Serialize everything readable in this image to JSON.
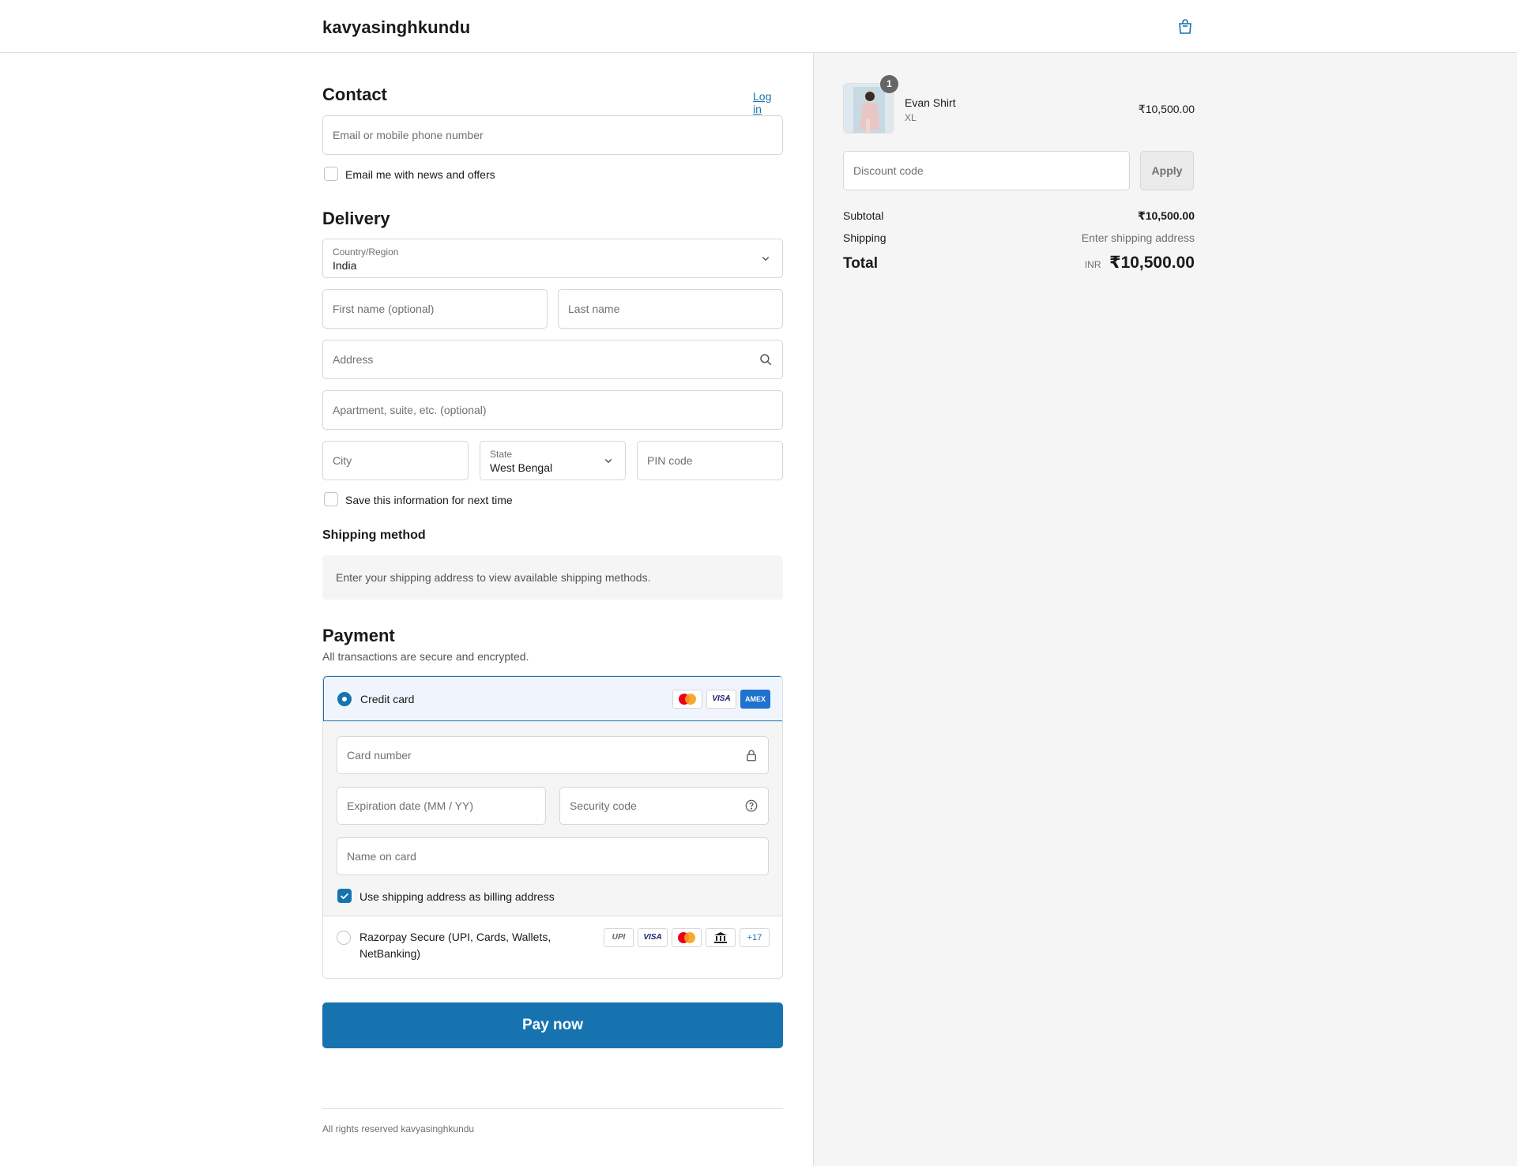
{
  "header": {
    "brand": "kavyasinghkundu",
    "bag_icon": "shopping-bag-icon"
  },
  "contact": {
    "title": "Contact",
    "login_label": "Log in",
    "email_placeholder": "Email or mobile phone number",
    "news_label": "Email me with news and offers"
  },
  "delivery": {
    "title": "Delivery",
    "country_label": "Country/Region",
    "country_value": "India",
    "first_name_placeholder": "First name (optional)",
    "last_name_placeholder": "Last name",
    "address_placeholder": "Address",
    "apartment_placeholder": "Apartment, suite, etc. (optional)",
    "city_placeholder": "City",
    "state_label": "State",
    "state_value": "West Bengal",
    "pin_placeholder": "PIN code",
    "save_label": "Save this information for next time"
  },
  "shipping": {
    "title": "Shipping method",
    "message": "Enter your shipping address to view available shipping methods."
  },
  "payment": {
    "title": "Payment",
    "subtitle": "All transactions are secure and encrypted.",
    "credit_card_label": "Credit card",
    "card_logos": [
      "mastercard",
      "VISA",
      "AMEX"
    ],
    "card_number_placeholder": "Card number",
    "expiry_placeholder": "Expiration date (MM / YY)",
    "security_placeholder": "Security code",
    "name_placeholder": "Name on card",
    "billing_label": "Use shipping address as billing address",
    "razorpay_label_1": "Razorpay Secure (UPI, Cards, Wallets,",
    "razorpay_label_2": "NetBanking)",
    "razorpay_logos": [
      "UPI",
      "VISA",
      "mastercard",
      "bank",
      "+17"
    ]
  },
  "pay_button": "Pay now",
  "footer": "All rights reserved kavyasinghkundu",
  "summary": {
    "item_name": "Evan Shirt",
    "item_variant": "XL",
    "item_qty": "1",
    "item_price": "₹10,500.00",
    "discount_placeholder": "Discount code",
    "apply_label": "Apply",
    "subtotal_label": "Subtotal",
    "subtotal_value": "₹10,500.00",
    "shipping_label": "Shipping",
    "shipping_value": "Enter shipping address",
    "total_label": "Total",
    "currency": "INR",
    "total_value": "₹10,500.00"
  },
  "colors": {
    "accent": "#1773b0",
    "panel": "#f5f5f5",
    "border": "#d6d6d6"
  }
}
